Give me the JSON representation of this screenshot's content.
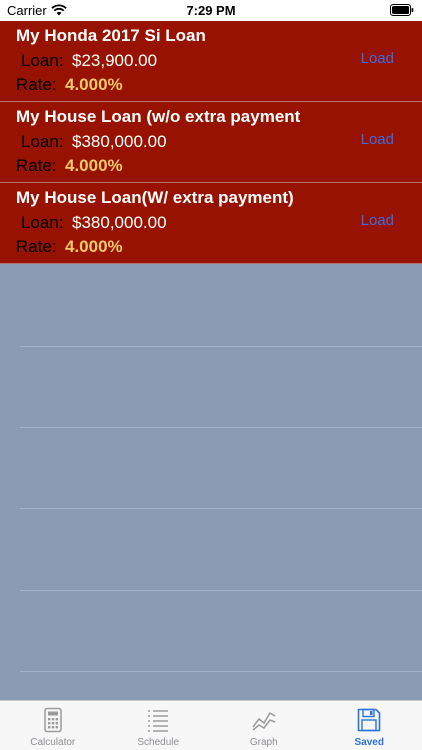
{
  "status_bar": {
    "carrier": "Carrier",
    "time": "7:29 PM"
  },
  "saved_loans": [
    {
      "name": "My Honda 2017 Si Loan",
      "loan_label": "Loan:",
      "loan_value": "$23,900.00",
      "rate_label": "Rate:",
      "rate_value": "4.000%",
      "action": "Load"
    },
    {
      "name": "My House Loan (w/o extra payment",
      "loan_label": "Loan:",
      "loan_value": "$380,000.00",
      "rate_label": "Rate:",
      "rate_value": "4.000%",
      "action": "Load"
    },
    {
      "name": "My House Loan(W/ extra payment)",
      "loan_label": "Loan:",
      "loan_value": "$380,000.00",
      "rate_label": "Rate:",
      "rate_value": "4.000%",
      "action": "Load"
    }
  ],
  "tab_bar": {
    "tabs": [
      {
        "label": "Calculator",
        "icon": "calculator-icon"
      },
      {
        "label": "Schedule",
        "icon": "schedule-list-icon"
      },
      {
        "label": "Graph",
        "icon": "graph-icon"
      },
      {
        "label": "Saved",
        "icon": "floppy-disk-icon"
      }
    ],
    "active": "Saved"
  },
  "colors": {
    "row_bg": "#971200",
    "rate": "#f2c86c",
    "accent": "#2b72d8",
    "empty_bg": "#8a9cb4"
  }
}
